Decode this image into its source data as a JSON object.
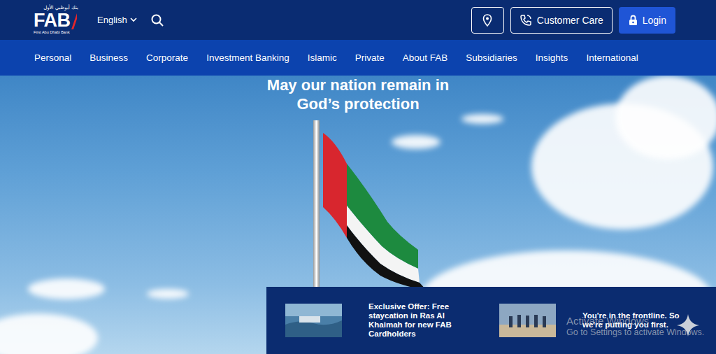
{
  "logo": {
    "arabic": "بنك أبوظبي الأول",
    "text": "FAB",
    "caption": "First Abu Dhabi Bank"
  },
  "language": {
    "label": "English"
  },
  "header_buttons": [
    {
      "label": "Customer Care"
    },
    {
      "label": "Login"
    }
  ],
  "nav": [
    {
      "label": "Personal"
    },
    {
      "label": "Business"
    },
    {
      "label": "Corporate"
    },
    {
      "label": "Investment Banking"
    },
    {
      "label": "Islamic"
    },
    {
      "label": "Private"
    },
    {
      "label": "About FAB"
    },
    {
      "label": "Subsidiaries"
    },
    {
      "label": "Insights"
    },
    {
      "label": "International"
    }
  ],
  "hero": {
    "headline": [
      "May our nation remain in",
      "God’s protection"
    ]
  },
  "promos": [
    {
      "text": "Exclusive Offer: Free staycation in Ras Al Khaimah for new FAB Cardholders"
    },
    {
      "text": "You're in the frontline. So we're putting you first."
    }
  ],
  "watermark": {
    "title": "Activate Windows",
    "subtitle": "Go to Settings to activate Windows."
  }
}
